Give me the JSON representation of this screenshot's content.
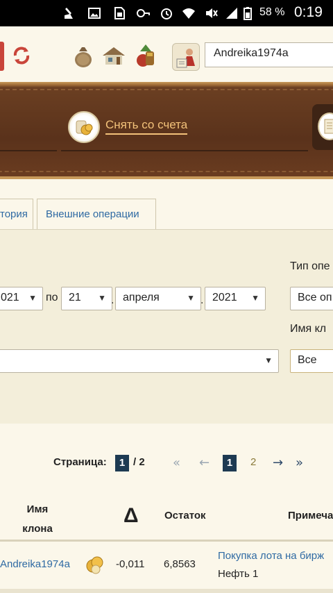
{
  "status_bar": {
    "battery": "58 %",
    "time": "0:19"
  },
  "toolbar": {
    "username": "Andreika1974a"
  },
  "banner": {
    "withdraw_label": "Снять со счета"
  },
  "tabs": [
    {
      "label": "тория"
    },
    {
      "label": "Внешние операции"
    }
  ],
  "filter": {
    "type_label": "Тип опе",
    "type_value": "Все оп",
    "date_from_year": "021",
    "to_label": "по",
    "date_to_day": "21",
    "date_to_month": "апреля",
    "date_to_year": "2021",
    "clone_label": "Имя кл",
    "clone_value": "Все",
    "period_value": ""
  },
  "pager": {
    "label": "Страница:",
    "current": "1",
    "of": "/ 2",
    "pages": [
      "1",
      "2"
    ],
    "first": "«",
    "prev": "←",
    "next": "→",
    "last": "»"
  },
  "table": {
    "headers": {
      "clone_name": "Имя клона",
      "delta": "Δ",
      "balance": "Остаток",
      "note": "Примеча"
    },
    "rows": [
      {
        "clone_name": "Andreika1974a",
        "delta": "-0,011",
        "balance": "6,8563",
        "note_link": "Покупка лота на бирж",
        "note_sub": "Нефть 1"
      }
    ]
  }
}
